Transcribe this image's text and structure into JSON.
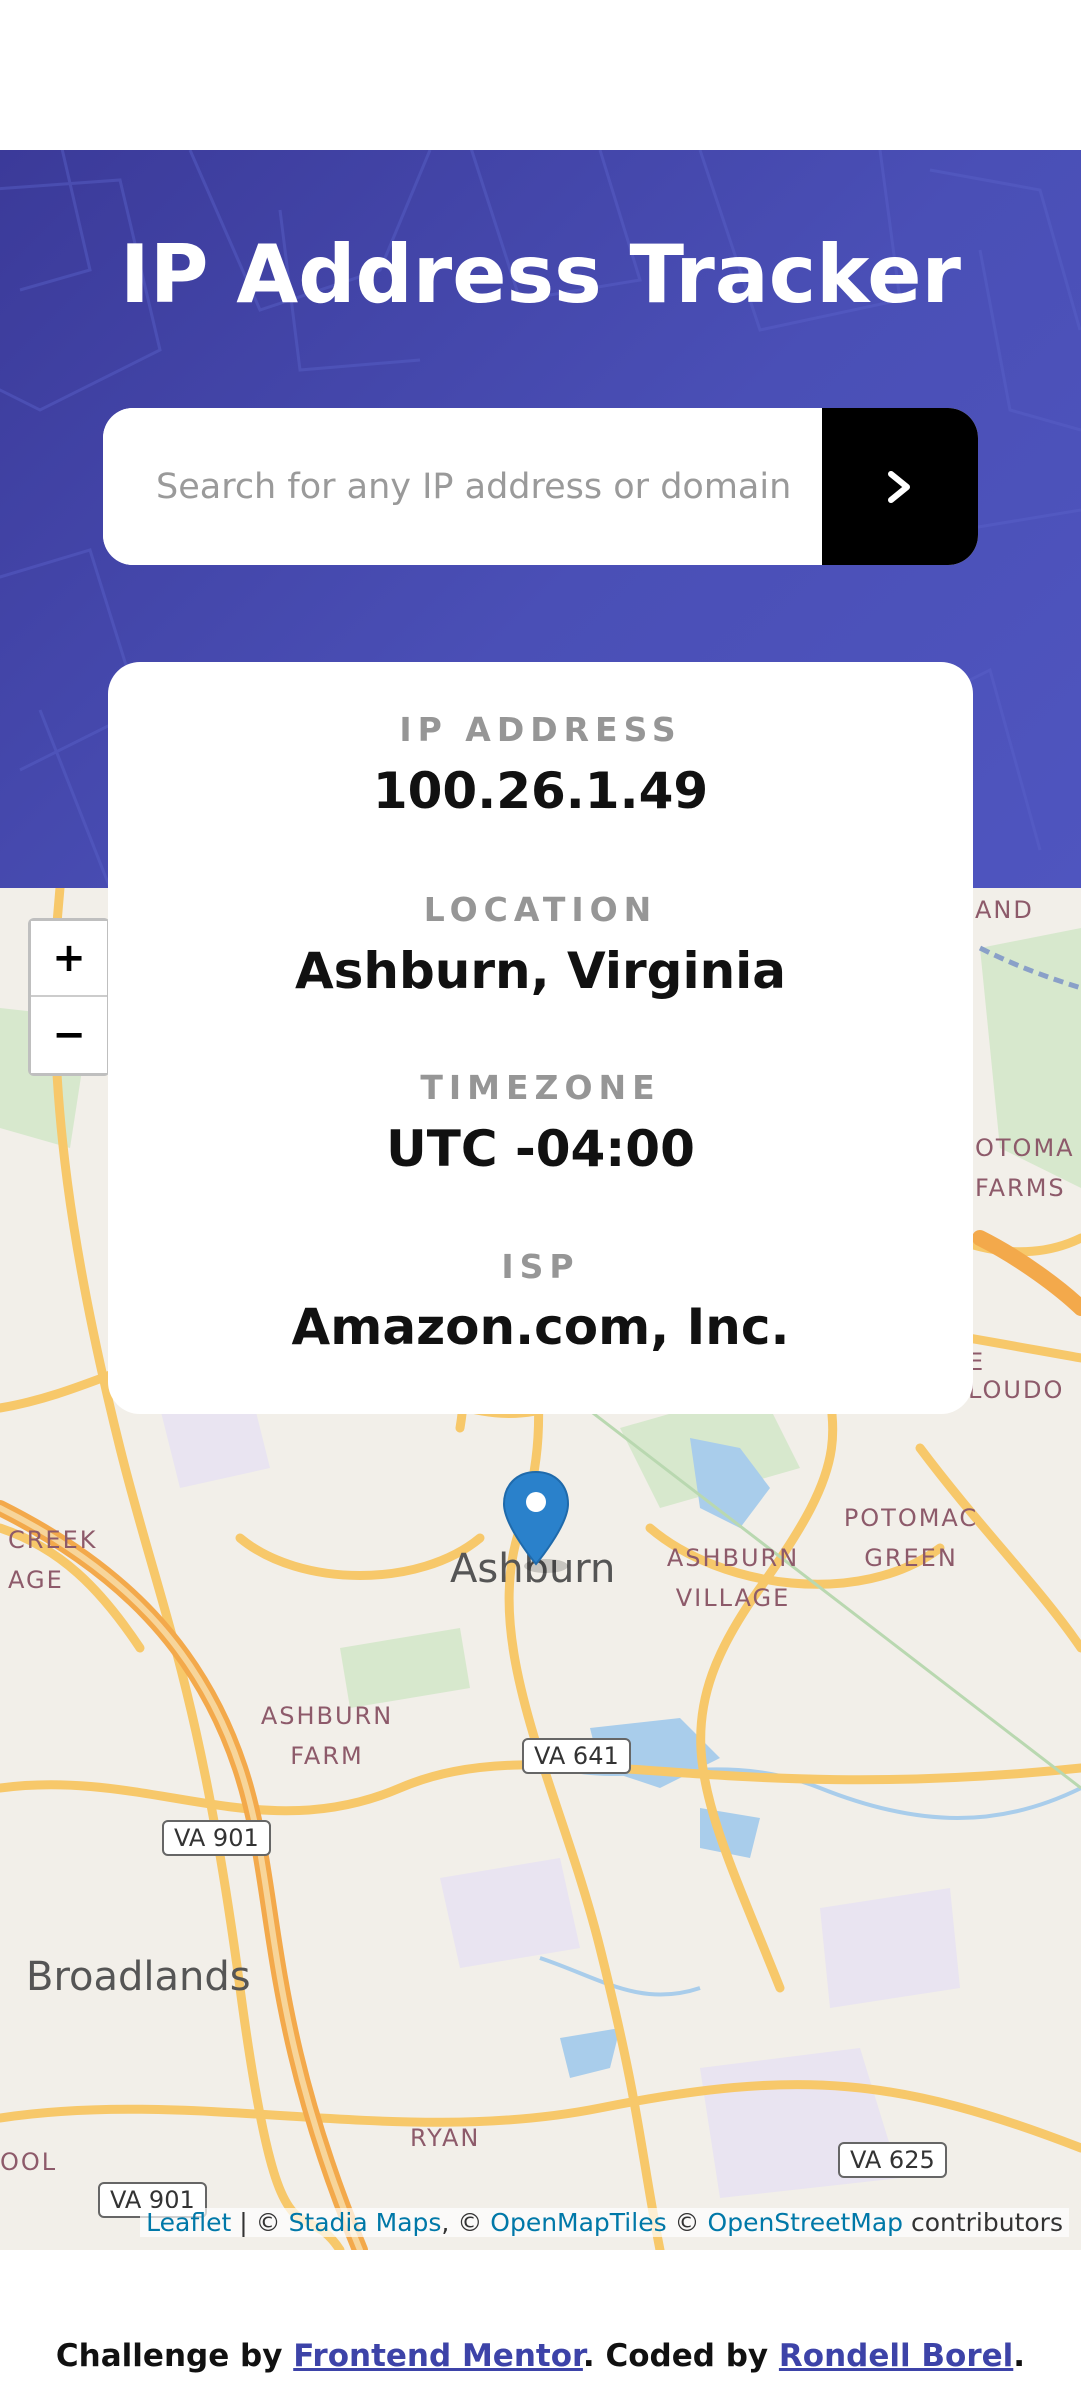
{
  "header": {
    "title": "IP Address Tracker"
  },
  "search": {
    "placeholder": "Search for any IP address or domain",
    "value": ""
  },
  "info": {
    "ip_label": "IP ADDRESS",
    "ip_value": "100.26.1.49",
    "location_label": "LOCATION",
    "location_value": "Ashburn, Virginia",
    "timezone_label": "TIMEZONE",
    "timezone_value": "UTC -04:00",
    "isp_label": "ISP",
    "isp_value": "Amazon.com, Inc."
  },
  "map": {
    "zoom_in": "+",
    "zoom_out": "−",
    "labels": {
      "ashburn": "Ashburn",
      "broadlands": "Broadlands",
      "ashburn_village_1": "ASHBURN",
      "ashburn_village_2": "VILLAGE",
      "potomac_green_1": "POTOMAC",
      "potomac_green_2": "GREEN",
      "ashburn_farm_1": "ASHBURN",
      "ashburn_farm_2": "FARM",
      "creek": "CREEK",
      "age": "AGE",
      "and": "AND",
      "potomac_farms_1": "OTOMA",
      "potomac_farms_2": "FARMS",
      "loudoun": "E LOUDO",
      "ryan": "RYAN",
      "ool": "OOL",
      "va641": "VA 641",
      "va901_a": "VA 901",
      "va901_b": "VA 901",
      "va625": "VA 625"
    },
    "attribution": {
      "leaflet": "Leaflet",
      "sep1": " | © ",
      "stadia": "Stadia Maps",
      "sep2": ", © ",
      "openmaptiles": "OpenMapTiles",
      "sep3": " © ",
      "osm": "OpenStreetMap",
      "tail": " contributors"
    }
  },
  "footer": {
    "prefix": "Challenge by ",
    "frontend_mentor": "Frontend Mentor",
    "middle": ". Coded by ",
    "author": "Rondell Borel",
    "suffix": "."
  },
  "colors": {
    "header_bg": "#4a4fb6",
    "search_button": "#000000",
    "marker": "#2a81cb",
    "roads": "#f7c86a",
    "water": "#a9cdeb",
    "link": "#0078a8"
  }
}
